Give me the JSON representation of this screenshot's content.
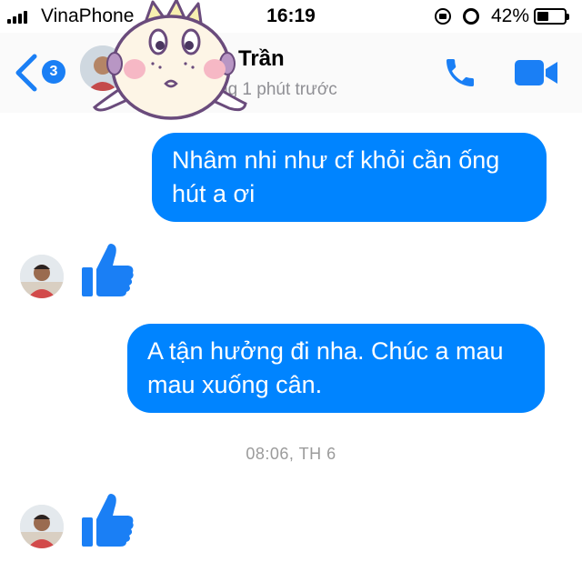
{
  "status_bar": {
    "carrier": "VinaPhone",
    "time": "16:19",
    "battery_percent": "42%",
    "battery_level": 0.42,
    "icons": [
      "signal-icon",
      "rotation-lock-icon",
      "alarm-icon",
      "battery-icon"
    ]
  },
  "header": {
    "unread_count": "3",
    "contact_name": "Trần",
    "last_active": "ng 1 phút trước",
    "icons": [
      "back-chevron-icon",
      "phone-icon",
      "video-camera-icon"
    ]
  },
  "colors": {
    "accent": "#0084ff",
    "bubble_text": "#ffffff",
    "timestamp": "#9b9b9b"
  },
  "messages": [
    {
      "type": "outgoing",
      "text": "Nhâm nhi như cf khỏi cần ống hút a ơi"
    },
    {
      "type": "incoming-like",
      "icon": "thumbs-up-icon"
    },
    {
      "type": "outgoing",
      "text": "A tận hưởng đi nha. Chúc a mau mau xuống cân."
    }
  ],
  "timestamp": "08:06, TH 6",
  "after_timestamp": {
    "type": "incoming-like",
    "icon": "thumbs-up-icon"
  }
}
